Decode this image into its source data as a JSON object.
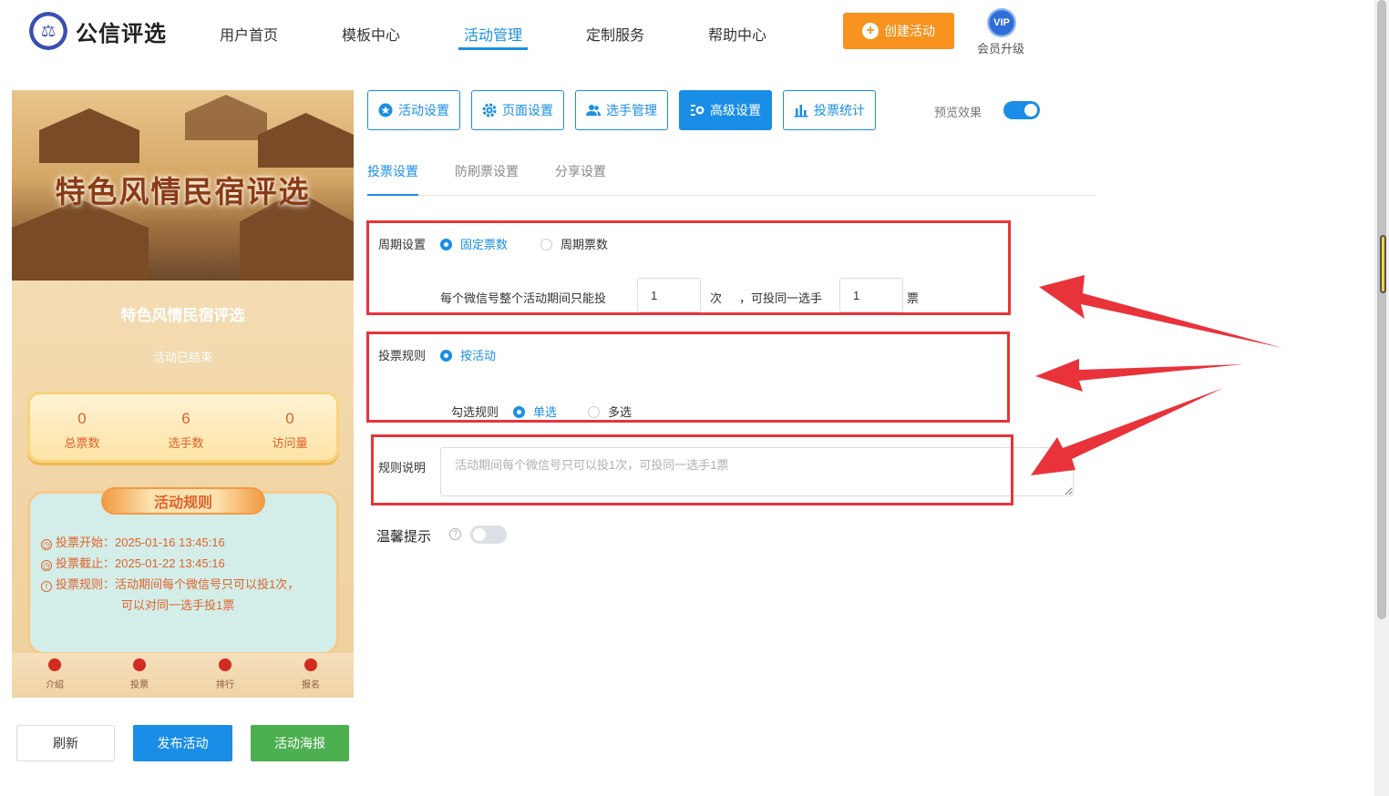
{
  "header": {
    "brand": "公信评选",
    "nav": [
      "用户首页",
      "模板中心",
      "活动管理",
      "定制服务",
      "帮助中心"
    ],
    "active_nav": "活动管理",
    "create_label": "创建活动",
    "vip_badge": "VIP",
    "vip_label": "会员升级"
  },
  "phone": {
    "banner_title": "特色风情民宿评选",
    "title": "特色风情民宿评选",
    "status": "活动已结束",
    "stats": [
      {
        "value": "0",
        "label": "总票数"
      },
      {
        "value": "6",
        "label": "选手数"
      },
      {
        "value": "0",
        "label": "访问量"
      }
    ],
    "rules_title": "活动规则",
    "rule_start": "投票开始：2025-01-16 13:45:16",
    "rule_end": "投票截止：2025-01-22 13:45:16",
    "rule_text_1": "投票规则：活动期间每个微信号只可以投1次，",
    "rule_text_2": "可以对同一选手投1票",
    "tabbar": [
      "介绍",
      "投票",
      "排行",
      "报名"
    ]
  },
  "actions": {
    "refresh": "刷新",
    "publish": "发布活动",
    "poster": "活动海报"
  },
  "settings_tabs": [
    "活动设置",
    "页面设置",
    "选手管理",
    "高级设置",
    "投票统计"
  ],
  "active_settings_tab": "高级设置",
  "preview_label": "预览效果",
  "sub_tabs": [
    "投票设置",
    "防刷票设置",
    "分享设置"
  ],
  "form": {
    "cycle_label": "周期设置",
    "cycle_fixed": "固定票数",
    "cycle_periodic": "周期票数",
    "cycle_text_1": "每个微信号整个活动期间只能投",
    "cycle_votes": "1",
    "cycle_text_2": "次",
    "cycle_text_3": "，可投同一选手",
    "cycle_same": "1",
    "cycle_text_4": "票",
    "rule_label": "投票规则",
    "rule_by_activity": "按活动",
    "check_label": "勾选规则",
    "check_single": "单选",
    "check_multi": "多选",
    "desc_label": "规则说明",
    "desc_placeholder": "活动期间每个微信号只可以投1次，可投同一选手1票",
    "tip_label": "温馨提示"
  },
  "colors": {
    "primary": "#1a8ee6",
    "orange": "#f7931e",
    "green": "#4caf50",
    "annotation_red": "#e8333a"
  }
}
